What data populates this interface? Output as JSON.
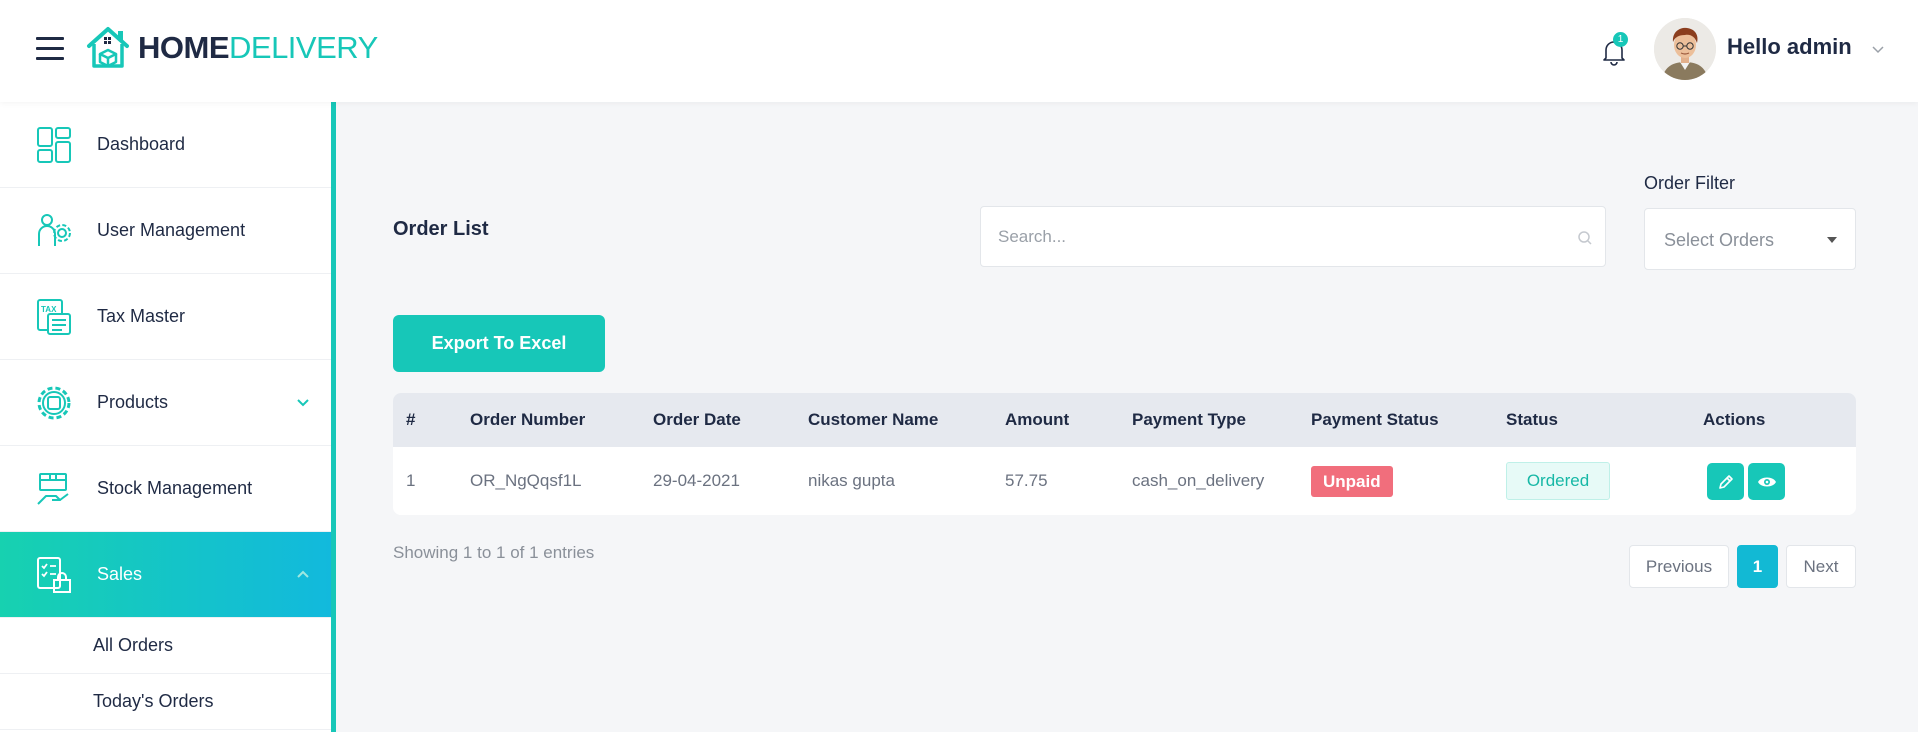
{
  "header": {
    "logo_home": "HOME",
    "logo_delivery": "DELIVERY",
    "notification_count": "1",
    "greeting": "Hello admin"
  },
  "sidebar": {
    "items": [
      {
        "label": "Dashboard",
        "icon": "dashboard-icon"
      },
      {
        "label": "User Management",
        "icon": "user-management-icon"
      },
      {
        "label": "Tax Master",
        "icon": "tax-icon"
      },
      {
        "label": "Products",
        "icon": "products-icon"
      },
      {
        "label": "Stock Management",
        "icon": "stock-icon"
      },
      {
        "label": "Sales",
        "icon": "sales-icon"
      }
    ],
    "sub_items": [
      {
        "label": "All Orders"
      },
      {
        "label": "Today's Orders"
      }
    ]
  },
  "main": {
    "title": "Order List",
    "search_placeholder": "Search...",
    "filter_label": "Order Filter",
    "filter_value": "Select Orders",
    "export_label": "Export To Excel",
    "table": {
      "headers": [
        "#",
        "Order Number",
        "Order Date",
        "Customer Name",
        "Amount",
        "Payment Type",
        "Payment Status",
        "Status",
        "Actions"
      ],
      "rows": [
        {
          "index": "1",
          "order_number": "OR_NgQqsf1L",
          "order_date": "29-04-2021",
          "customer_name": "nikas gupta",
          "amount": "57.75",
          "payment_type": "cash_on_delivery",
          "payment_status": "Unpaid",
          "status": "Ordered"
        }
      ]
    },
    "showing": "Showing 1 to 1 of 1 entries",
    "pagination": {
      "previous": "Previous",
      "current": "1",
      "next": "Next"
    }
  },
  "colors": {
    "accent": "#17c7b8",
    "unpaid": "#f16e7c",
    "active_page": "#12b9d4"
  }
}
